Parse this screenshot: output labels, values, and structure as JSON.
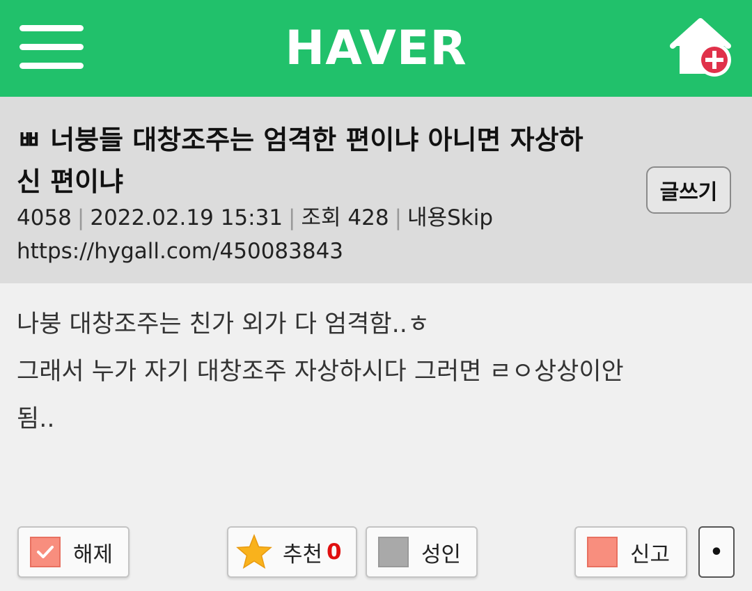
{
  "header": {
    "logo": "HAVER",
    "menu_icon": "hamburger-menu-icon",
    "home_add_icon": "home-plus-icon",
    "brand_color": "#21c16b"
  },
  "post": {
    "title_line1": "ㅃ 너붕들 대창조주는 엄격한 편이냐 아니면 자상하",
    "title_line2": "신 편이냐",
    "write_label": "글쓰기",
    "post_number": "4058",
    "datetime": "2022.02.19 15:31",
    "views": "조회 428",
    "skip_label": "내용Skip",
    "url": "https://hygall.com/450083843",
    "body": [
      "나붕 대창조주는 친가 외가 다 엄격함..ㅎ",
      "그래서 누가 자기 대창조주 자상하시다 그러면 ㄹㅇ상상이안",
      "됨.."
    ]
  },
  "actions": {
    "release_label": "해제",
    "recommend_label": "추천",
    "recommend_count": "0",
    "adult_label": "성인",
    "report_label": "신고",
    "more_label": "•"
  }
}
